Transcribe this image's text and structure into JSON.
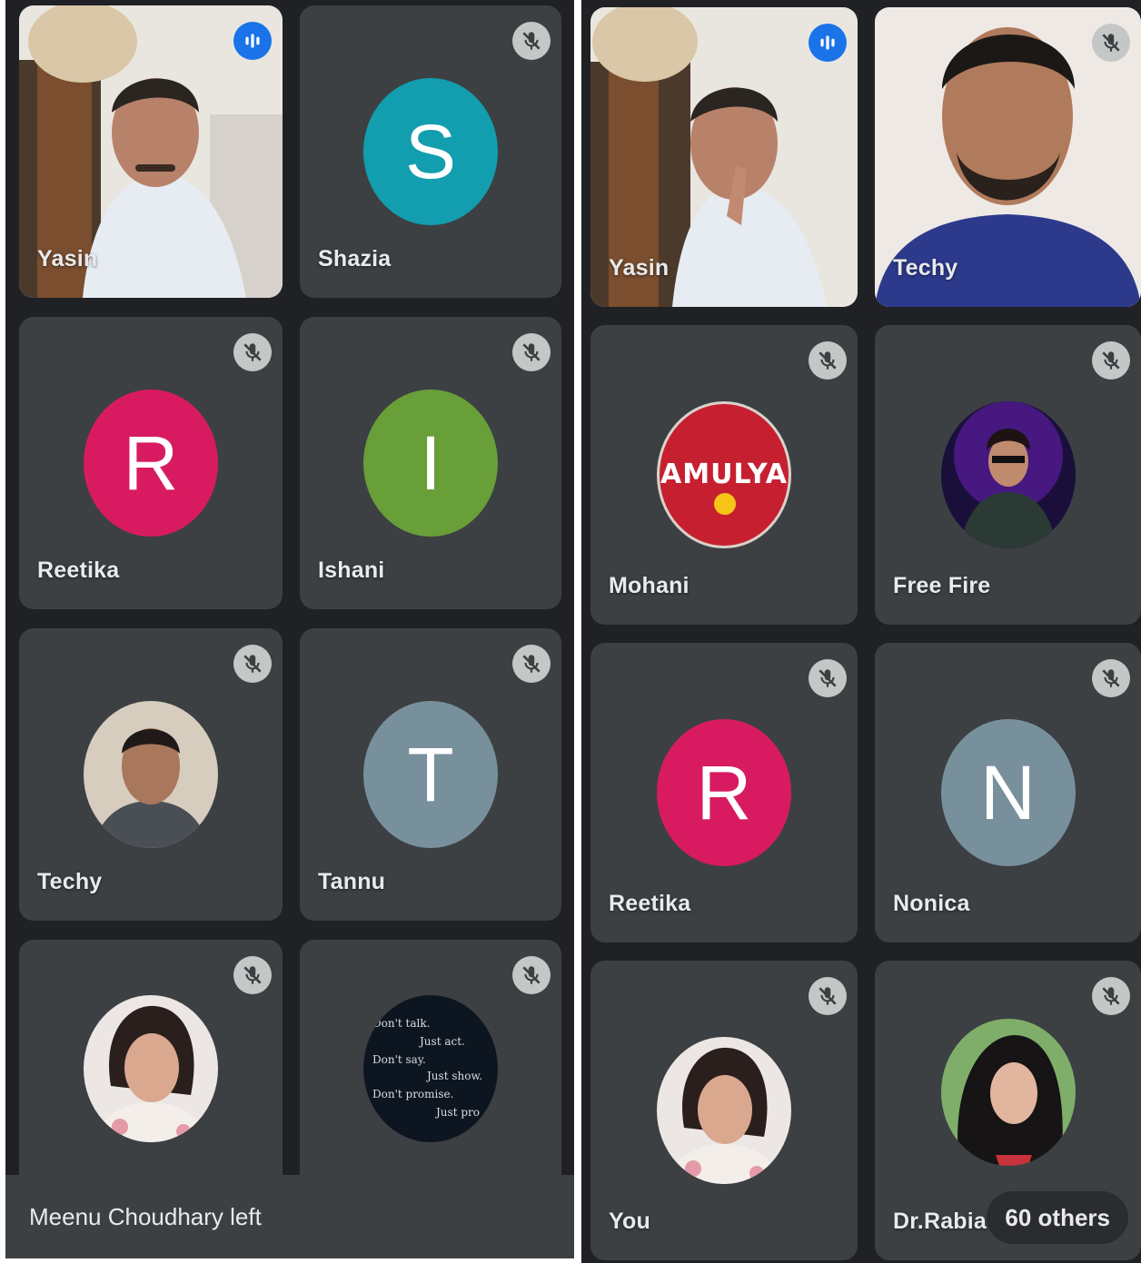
{
  "left_screen": {
    "tiles": [
      {
        "name": "Yasin",
        "type": "video",
        "status": "speaking"
      },
      {
        "name": "Shazia",
        "type": "initial",
        "initial": "S",
        "color": "#129eaf",
        "status": "muted"
      },
      {
        "name": "Reetika",
        "type": "initial",
        "initial": "R",
        "color": "#d81b60",
        "status": "muted"
      },
      {
        "name": "Ishani",
        "type": "initial",
        "initial": "I",
        "color": "#689f38",
        "status": "muted"
      },
      {
        "name": "Techy",
        "type": "photo",
        "status": "muted"
      },
      {
        "name": "Tannu",
        "type": "initial",
        "initial": "T",
        "color": "#78909c",
        "status": "muted"
      },
      {
        "name": "",
        "type": "photo",
        "status": "muted"
      },
      {
        "name": "",
        "type": "quote-photo",
        "status": "muted",
        "quote_lines": [
          "Don't talk.",
          "Just act.",
          "Don't say.",
          "Just show.",
          "Don't promise.",
          "Just pro"
        ]
      }
    ],
    "toast": "Meenu Choudhary left"
  },
  "right_screen": {
    "tiles": [
      {
        "name": "Yasin",
        "type": "video",
        "status": "speaking"
      },
      {
        "name": "Techy",
        "type": "video",
        "status": "muted"
      },
      {
        "name": "Mohani",
        "type": "photo",
        "photo_text": "AMULYA",
        "status": "muted"
      },
      {
        "name": "Free Fire",
        "type": "photo",
        "status": "muted"
      },
      {
        "name": "Reetika",
        "type": "initial",
        "initial": "R",
        "color": "#d81b60",
        "status": "muted"
      },
      {
        "name": "Nonica",
        "type": "initial",
        "initial": "N",
        "color": "#78909c",
        "status": "muted"
      },
      {
        "name": "You",
        "type": "photo",
        "status": "muted"
      },
      {
        "name": "Dr.Rabia",
        "type": "photo",
        "status": "muted"
      }
    ],
    "others_label": "60 others"
  },
  "icons": {
    "muted": "mic-off-icon",
    "speaking": "audio-level-icon"
  },
  "colors": {
    "background": "#202124",
    "tile": "#3c4043",
    "speaking": "#1a73e8"
  }
}
